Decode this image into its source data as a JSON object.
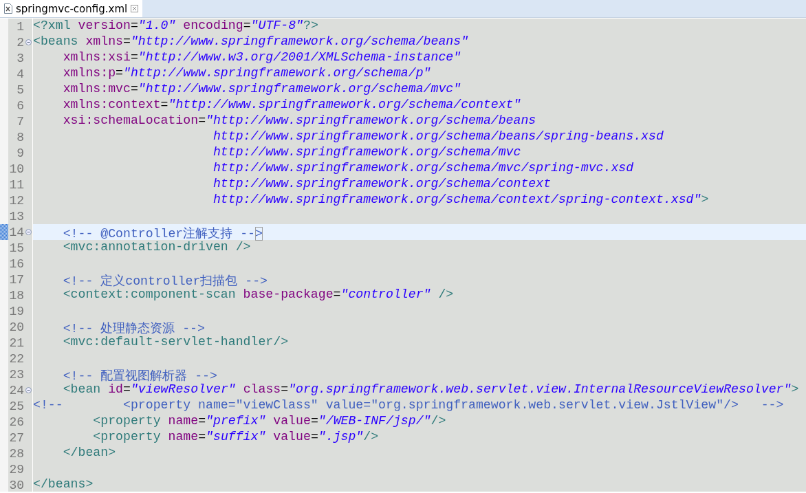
{
  "tab": {
    "title": "springmvc-config.xml",
    "selected": true
  },
  "lines": [
    {
      "number": "1",
      "foldable": false,
      "current": false,
      "tokens": [
        {
          "kind": "tag",
          "text": "<?xml"
        },
        {
          "kind": "attr",
          "text": " version"
        },
        {
          "kind": "eq",
          "text": "="
        },
        {
          "kind": "str",
          "text": "\"1.0\""
        },
        {
          "kind": "attr",
          "text": " encoding"
        },
        {
          "kind": "eq",
          "text": "="
        },
        {
          "kind": "str",
          "text": "\"UTF-8\""
        },
        {
          "kind": "tag",
          "text": "?>"
        }
      ]
    },
    {
      "number": "2",
      "foldable": true,
      "current": false,
      "tokens": [
        {
          "kind": "tag",
          "text": "<beans"
        },
        {
          "kind": "attr",
          "text": " xmlns"
        },
        {
          "kind": "eq",
          "text": "="
        },
        {
          "kind": "str",
          "text": "\"http://www.springframework.org/schema/beans\""
        }
      ]
    },
    {
      "number": "3",
      "foldable": false,
      "current": false,
      "tokens": [
        {
          "kind": "attr",
          "text": "    xmlns:xsi"
        },
        {
          "kind": "eq",
          "text": "="
        },
        {
          "kind": "str",
          "text": "\"http://www.w3.org/2001/XMLSchema-instance\""
        }
      ]
    },
    {
      "number": "4",
      "foldable": false,
      "current": false,
      "tokens": [
        {
          "kind": "attr",
          "text": "    xmlns:p"
        },
        {
          "kind": "eq",
          "text": "="
        },
        {
          "kind": "str",
          "text": "\"http://www.springframework.org/schema/p\""
        }
      ]
    },
    {
      "number": "5",
      "foldable": false,
      "current": false,
      "tokens": [
        {
          "kind": "attr",
          "text": "    xmlns:mvc"
        },
        {
          "kind": "eq",
          "text": "="
        },
        {
          "kind": "str",
          "text": "\"http://www.springframework.org/schema/mvc\""
        }
      ]
    },
    {
      "number": "6",
      "foldable": false,
      "current": false,
      "tokens": [
        {
          "kind": "attr",
          "text": "    xmlns:context"
        },
        {
          "kind": "eq",
          "text": "="
        },
        {
          "kind": "str",
          "text": "\"http://www.springframework.org/schema/context\""
        }
      ]
    },
    {
      "number": "7",
      "foldable": false,
      "current": false,
      "tokens": [
        {
          "kind": "attr",
          "text": "    xsi:schemaLocation"
        },
        {
          "kind": "eq",
          "text": "="
        },
        {
          "kind": "str",
          "text": "\"http://www.springframework.org/schema/beans"
        }
      ]
    },
    {
      "number": "8",
      "foldable": false,
      "current": false,
      "tokens": [
        {
          "kind": "str",
          "text": "                        http://www.springframework.org/schema/beans/spring-beans.xsd"
        }
      ]
    },
    {
      "number": "9",
      "foldable": false,
      "current": false,
      "tokens": [
        {
          "kind": "str",
          "text": "                        http://www.springframework.org/schema/mvc"
        }
      ]
    },
    {
      "number": "10",
      "foldable": false,
      "current": false,
      "tokens": [
        {
          "kind": "str",
          "text": "                        http://www.springframework.org/schema/mvc/spring-mvc.xsd"
        }
      ]
    },
    {
      "number": "11",
      "foldable": false,
      "current": false,
      "tokens": [
        {
          "kind": "str",
          "text": "                        http://www.springframework.org/schema/context"
        }
      ]
    },
    {
      "number": "12",
      "foldable": false,
      "current": false,
      "tokens": [
        {
          "kind": "str",
          "text": "                        http://www.springframework.org/schema/context/spring-context.xsd\""
        },
        {
          "kind": "tag",
          "text": ">"
        }
      ]
    },
    {
      "number": "13",
      "foldable": false,
      "current": false
    },
    {
      "number": "14",
      "foldable": true,
      "current": true,
      "tokens": [
        {
          "kind": "comment",
          "text": "    <!-- @Controller注解支持 --"
        },
        {
          "kind": "match",
          "text": ">"
        }
      ]
    },
    {
      "number": "15",
      "foldable": false,
      "current": false,
      "tokens": [
        {
          "kind": "tag",
          "text": "    <mvc:annotation-driven />"
        }
      ]
    },
    {
      "number": "16",
      "foldable": false,
      "current": false
    },
    {
      "number": "17",
      "foldable": false,
      "current": false,
      "tokens": [
        {
          "kind": "comment",
          "text": "    <!-- 定义controller扫描包 -->"
        }
      ]
    },
    {
      "number": "18",
      "foldable": false,
      "current": false,
      "tokens": [
        {
          "kind": "tag",
          "text": "    <context:component-scan"
        },
        {
          "kind": "attr",
          "text": " base-package"
        },
        {
          "kind": "eq",
          "text": "="
        },
        {
          "kind": "str",
          "text": "\"controller\""
        },
        {
          "kind": "tag",
          "text": " />"
        }
      ]
    },
    {
      "number": "19",
      "foldable": false,
      "current": false
    },
    {
      "number": "20",
      "foldable": false,
      "current": false,
      "tokens": [
        {
          "kind": "comment",
          "text": "    <!-- 处理静态资源 -->"
        }
      ]
    },
    {
      "number": "21",
      "foldable": false,
      "current": false,
      "tokens": [
        {
          "kind": "tag",
          "text": "    <mvc:default-servlet-handler/>"
        }
      ]
    },
    {
      "number": "22",
      "foldable": false,
      "current": false
    },
    {
      "number": "23",
      "foldable": false,
      "current": false,
      "tokens": [
        {
          "kind": "comment",
          "text": "    <!-- 配置视图解析器 -->"
        }
      ]
    },
    {
      "number": "24",
      "foldable": true,
      "current": false,
      "tokens": [
        {
          "kind": "tag",
          "text": "    <bean"
        },
        {
          "kind": "attr",
          "text": " id"
        },
        {
          "kind": "eq",
          "text": "="
        },
        {
          "kind": "str",
          "text": "\"viewResolver\""
        },
        {
          "kind": "attr",
          "text": " class"
        },
        {
          "kind": "eq",
          "text": "="
        },
        {
          "kind": "str",
          "text": "\"org.springframework.web.servlet.view.InternalResourceViewResolver\""
        },
        {
          "kind": "tag",
          "text": ">"
        }
      ]
    },
    {
      "number": "25",
      "foldable": false,
      "current": false,
      "tokens": [
        {
          "kind": "comment",
          "text": "<!--        <property name=\"viewClass\" value=\"org.springframework.web.servlet.view.JstlView\"/>   -->"
        }
      ]
    },
    {
      "number": "26",
      "foldable": false,
      "current": false,
      "tokens": [
        {
          "kind": "tag",
          "text": "        <property"
        },
        {
          "kind": "attr",
          "text": " name"
        },
        {
          "kind": "eq",
          "text": "="
        },
        {
          "kind": "str",
          "text": "\"prefix\""
        },
        {
          "kind": "attr",
          "text": " value"
        },
        {
          "kind": "eq",
          "text": "="
        },
        {
          "kind": "str",
          "text": "\"/WEB-INF/jsp/\""
        },
        {
          "kind": "tag",
          "text": "/>"
        }
      ]
    },
    {
      "number": "27",
      "foldable": false,
      "current": false,
      "tokens": [
        {
          "kind": "tag",
          "text": "        <property"
        },
        {
          "kind": "attr",
          "text": " name"
        },
        {
          "kind": "eq",
          "text": "="
        },
        {
          "kind": "str",
          "text": "\"suffix\""
        },
        {
          "kind": "attr",
          "text": " value"
        },
        {
          "kind": "eq",
          "text": "="
        },
        {
          "kind": "str",
          "text": "\".jsp\""
        },
        {
          "kind": "tag",
          "text": "/>"
        }
      ]
    },
    {
      "number": "28",
      "foldable": false,
      "current": false,
      "tokens": [
        {
          "kind": "tag",
          "text": "    </bean>"
        }
      ]
    },
    {
      "number": "29",
      "foldable": false,
      "current": false
    },
    {
      "number": "30",
      "foldable": false,
      "current": false,
      "tokens": [
        {
          "kind": "tag",
          "text": "</beans>"
        }
      ]
    }
  ]
}
